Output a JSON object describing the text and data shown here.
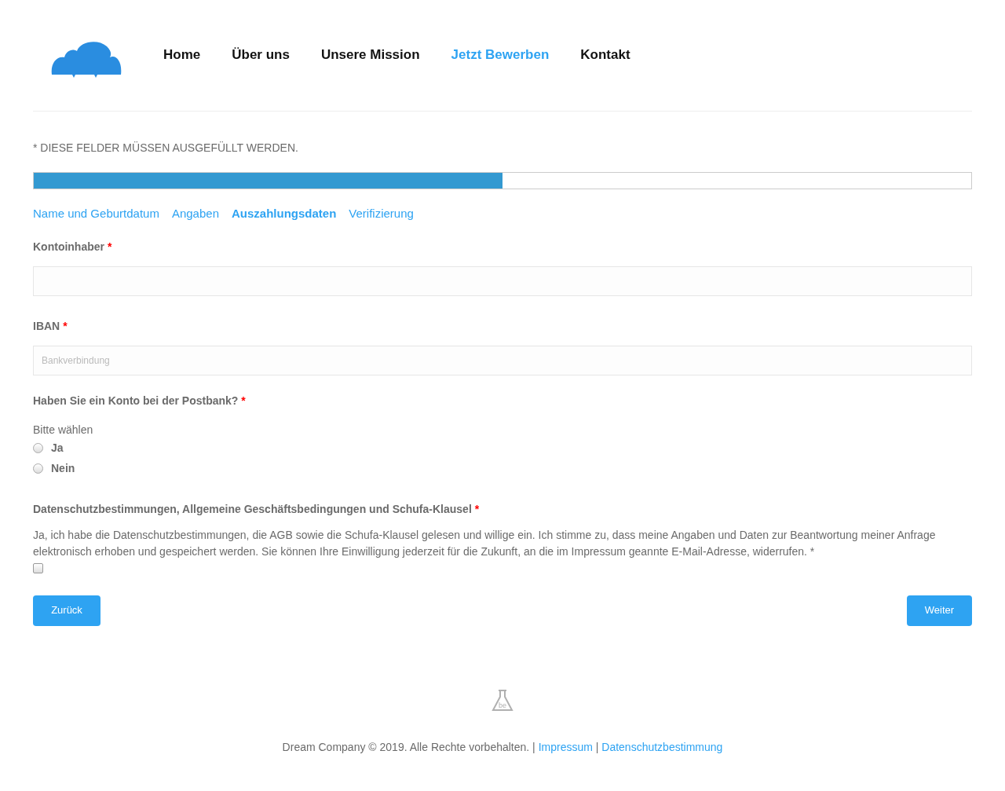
{
  "nav": [
    {
      "label": "Home",
      "selected": false
    },
    {
      "label": "Über uns",
      "selected": false
    },
    {
      "label": "Unsere Mission",
      "selected": false
    },
    {
      "label": "Jetzt Bewerben",
      "selected": true
    },
    {
      "label": "Kontakt",
      "selected": false
    }
  ],
  "required_note": "* DIESE FELDER MÜSSEN AUSGEFÜLLT WERDEN.",
  "progress": {
    "level": 0.5
  },
  "steps": [
    {
      "label": "Name und Geburtdatum",
      "selected": false
    },
    {
      "label": "Angaben",
      "selected": false
    },
    {
      "label": "Auszahlungsdaten",
      "selected": true
    },
    {
      "label": "Verifizierung",
      "selected": false
    }
  ],
  "fields": [
    {
      "label": "Kontoinhaber",
      "required_mark": "*"
    },
    {
      "label": "IBAN",
      "required_mark": "*",
      "placeholder": "Bankverbindung"
    }
  ],
  "postbank": {
    "label": "Haben Sie ein Konto bei der Postbank?",
    "required_mark": "*",
    "hint": "Bitte wählen",
    "options": [
      {
        "label": "Ja",
        "selected": false
      },
      {
        "label": "Nein",
        "selected": false
      }
    ]
  },
  "consent": {
    "label": "Datenschutzbestimmungen, Allgemeine Geschäftsbedingungen und Schufa-Klausel",
    "required_mark": "*",
    "text": "Ja, ich habe die Datenschutzbestimmungen, die AGB sowie die Schufa-Klausel gelesen und willige ein. Ich stimme zu, dass meine Angaben und Daten zur Beantwortung meiner Anfrage elektronisch erhoben und gespeichert werden. Sie können Ihre Einwilligung jederzeit für die Zukunft, an die im Impressum geannte E-Mail-Adresse, widerrufen. *",
    "checked": false
  },
  "buttons": {
    "back": "Zurück",
    "next": "Weiter"
  },
  "footer": {
    "logo_text": "be",
    "copyright": "Dream Company © 2019. Alle Rechte vorbehalten.",
    "separator_1": "|",
    "link_1": "Impressum",
    "separator_2": "|",
    "link_2": "Datenschutzbestimmung"
  }
}
